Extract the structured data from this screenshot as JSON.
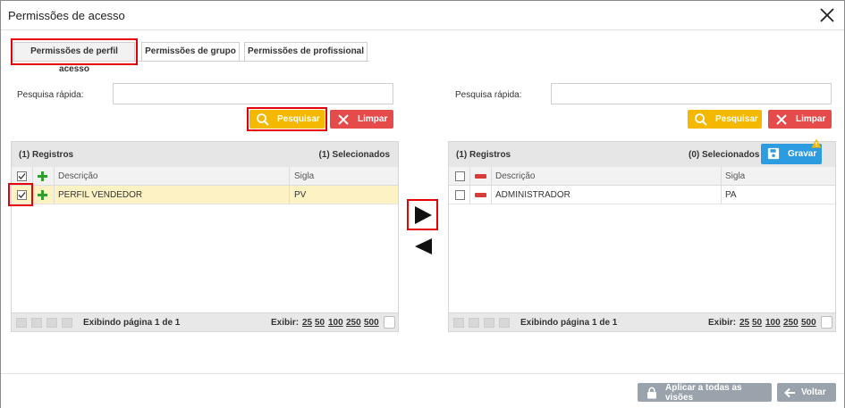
{
  "window": {
    "title": "Permissões de acesso"
  },
  "tabs": [
    {
      "label": "Permissões de perfil acesso",
      "active": true
    },
    {
      "label": "Permissões de grupo",
      "active": false
    },
    {
      "label": "Permissões de profissional",
      "active": false
    }
  ],
  "left": {
    "search_label": "Pesquisa rápida:",
    "search_value": "",
    "search_button": "Pesquisar",
    "clear_button": "Limpar",
    "records": "(1) Registros",
    "selected": "(1) Selecionados",
    "columns": {
      "description": "Descrição",
      "acronym": "Sigla"
    },
    "rows": [
      {
        "description": "PERFIL VENDEDOR",
        "acronym": "PV",
        "checked": true
      }
    ],
    "pager": {
      "info": "Exibindo página 1 de 1",
      "show_label": "Exibir:",
      "sizes": [
        "25",
        "50",
        "100",
        "250",
        "500"
      ]
    }
  },
  "right": {
    "search_label": "Pesquisa rápida:",
    "search_value": "",
    "search_button": "Pesquisar",
    "clear_button": "Limpar",
    "records": "(1) Registros",
    "selected": "(0) Selecionados",
    "save_button": "Gravar",
    "columns": {
      "description": "Descrição",
      "acronym": "Sigla"
    },
    "rows": [
      {
        "description": "ADMINISTRADOR",
        "acronym": "PA",
        "checked": false
      }
    ],
    "pager": {
      "info": "Exibindo página 1 de 1",
      "show_label": "Exibir:",
      "sizes": [
        "25",
        "50",
        "100",
        "250",
        "500"
      ]
    }
  },
  "footer": {
    "apply_button": "Aplicar a todas as visões",
    "back_button": "Voltar"
  },
  "colors": {
    "search": "#f4b800",
    "clear": "#e54b4b",
    "save": "#2c9be0",
    "highlight": "#e3000b",
    "selected_row": "#fdf2c4",
    "footer_button": "#9aa3ab"
  },
  "icons": [
    "close-icon",
    "search-icon",
    "x-icon",
    "plus-icon",
    "minus-icon",
    "save-icon",
    "warning-icon",
    "lock-icon",
    "arrow-left-icon",
    "move-right-icon",
    "move-left-icon",
    "bulb-icon"
  ]
}
